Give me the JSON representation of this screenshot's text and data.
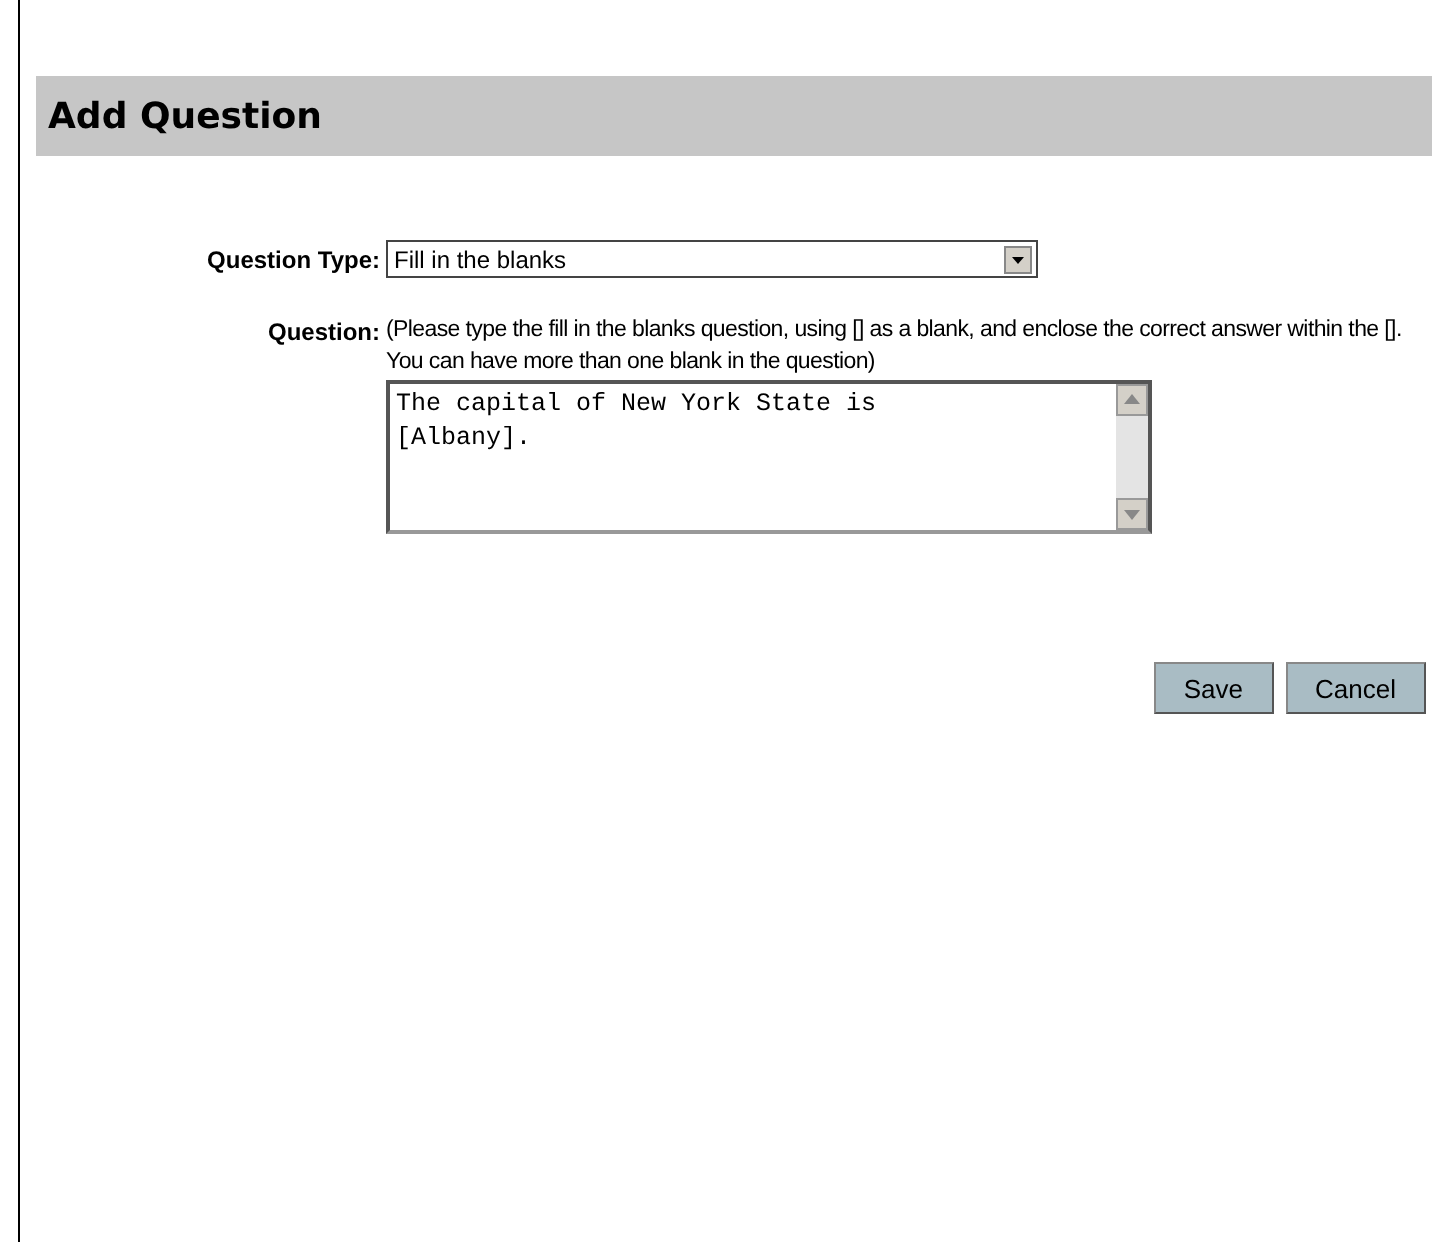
{
  "header": {
    "title": "Add Question"
  },
  "form": {
    "question_type": {
      "label": "Question Type:",
      "value": "Fill in the blanks"
    },
    "question": {
      "label": "Question:",
      "help": "(Please type the fill in the blanks question, using [] as a blank, and enclose the correct answer within the []. You can have more than one blank in the question)",
      "value": "The capital of New York State is\n[Albany]."
    }
  },
  "buttons": [
    "Save",
    "Cancel"
  ]
}
